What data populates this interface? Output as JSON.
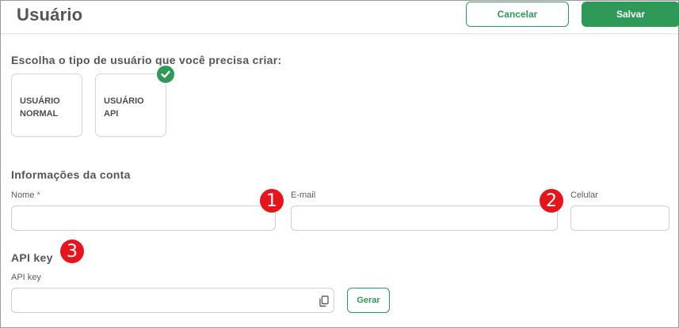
{
  "header": {
    "title": "Usuário",
    "cancel_label": "Cancelar",
    "save_label": "Salvar"
  },
  "user_type": {
    "prompt": "Escolha o tipo de usuário que você precisa criar:",
    "options": [
      {
        "line1": "USUÁRIO",
        "line2": "NORMAL",
        "selected": false
      },
      {
        "line1": "USUÁRIO",
        "line2": "API",
        "selected": true
      }
    ]
  },
  "account": {
    "section_title": "Informações da conta",
    "name_label": "Nome",
    "name_required_mark": "*",
    "name_value": "",
    "email_label": "E-mail",
    "email_value": "",
    "phone_label": "Celular",
    "phone_value": ""
  },
  "api": {
    "section_title": "API key",
    "field_label": "API key",
    "field_value": "",
    "generate_label": "Gerar"
  },
  "markers": [
    "1",
    "2",
    "3"
  ],
  "colors": {
    "accent_green": "#2f9a58",
    "marker_red": "#e8141b"
  },
  "icons": {
    "selected_check": "check-icon",
    "copy": "copy-icon"
  }
}
